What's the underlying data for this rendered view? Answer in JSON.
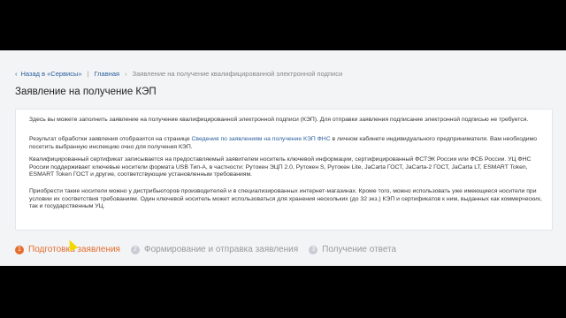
{
  "breadcrumbs": {
    "back_arrow": "‹",
    "back_label": "Назад в «Сервисы»",
    "home": "Главная",
    "separator": "›",
    "current": "Заявление на получение квалифицированной электронной подписи"
  },
  "page_title": "Заявление на получение КЭП",
  "paragraphs": {
    "p1": "Здесь вы можете заполнить заявление на получение квалифицированной электронной подписи (КЭП). Для отправки заявления подписание электронной подписью не требуется.",
    "p2_start": "Результат обработки заявления отобразится на странице ",
    "p2_link": "Сведения по заявлениям на получение КЭП ФНС",
    "p2_end": " в личном кабинете индивидуального предпринимателя. Вам необходимо посетить выбранную инспекцию очно для получения КЭП.",
    "p3": "Квалифицированный сертификат записывается на предоставляемый заявителем носитель ключевой информации, сертифицированный ФСТЭК России или ФСБ России. УЦ ФНС России поддерживает ключевые носители формата USB Тип-А, в частности: Рутокен ЭЦП 2.0, Рутокен S, Рутокен Lite, JaCarta ГОСТ, JaCarta-2 ГОСТ, JaCarta LT, ESMART Token, ESMART Token ГОСТ и другие, соответствующие установленным требованиям.",
    "p4": "Приобрести такие носители можно у дистрибьюторов производителей и в специализированных интернет-магазинах. Кроме того, можно использовать уже имеющиеся носители при условии их соответствия требованиям. Один ключевой носитель может использоваться для хранения нескольких (до 32 экз.) КЭП и сертификатов к ним, выданных как коммерческих, так и государственным УЦ."
  },
  "steps": [
    {
      "num": "1",
      "label": "Подготовка заявления"
    },
    {
      "num": "2",
      "label": "Формирование и отправка заявления"
    },
    {
      "num": "3",
      "label": "Получение ответа"
    }
  ],
  "colors": {
    "accent": "#e46c2c",
    "link": "#2b5f9e"
  }
}
